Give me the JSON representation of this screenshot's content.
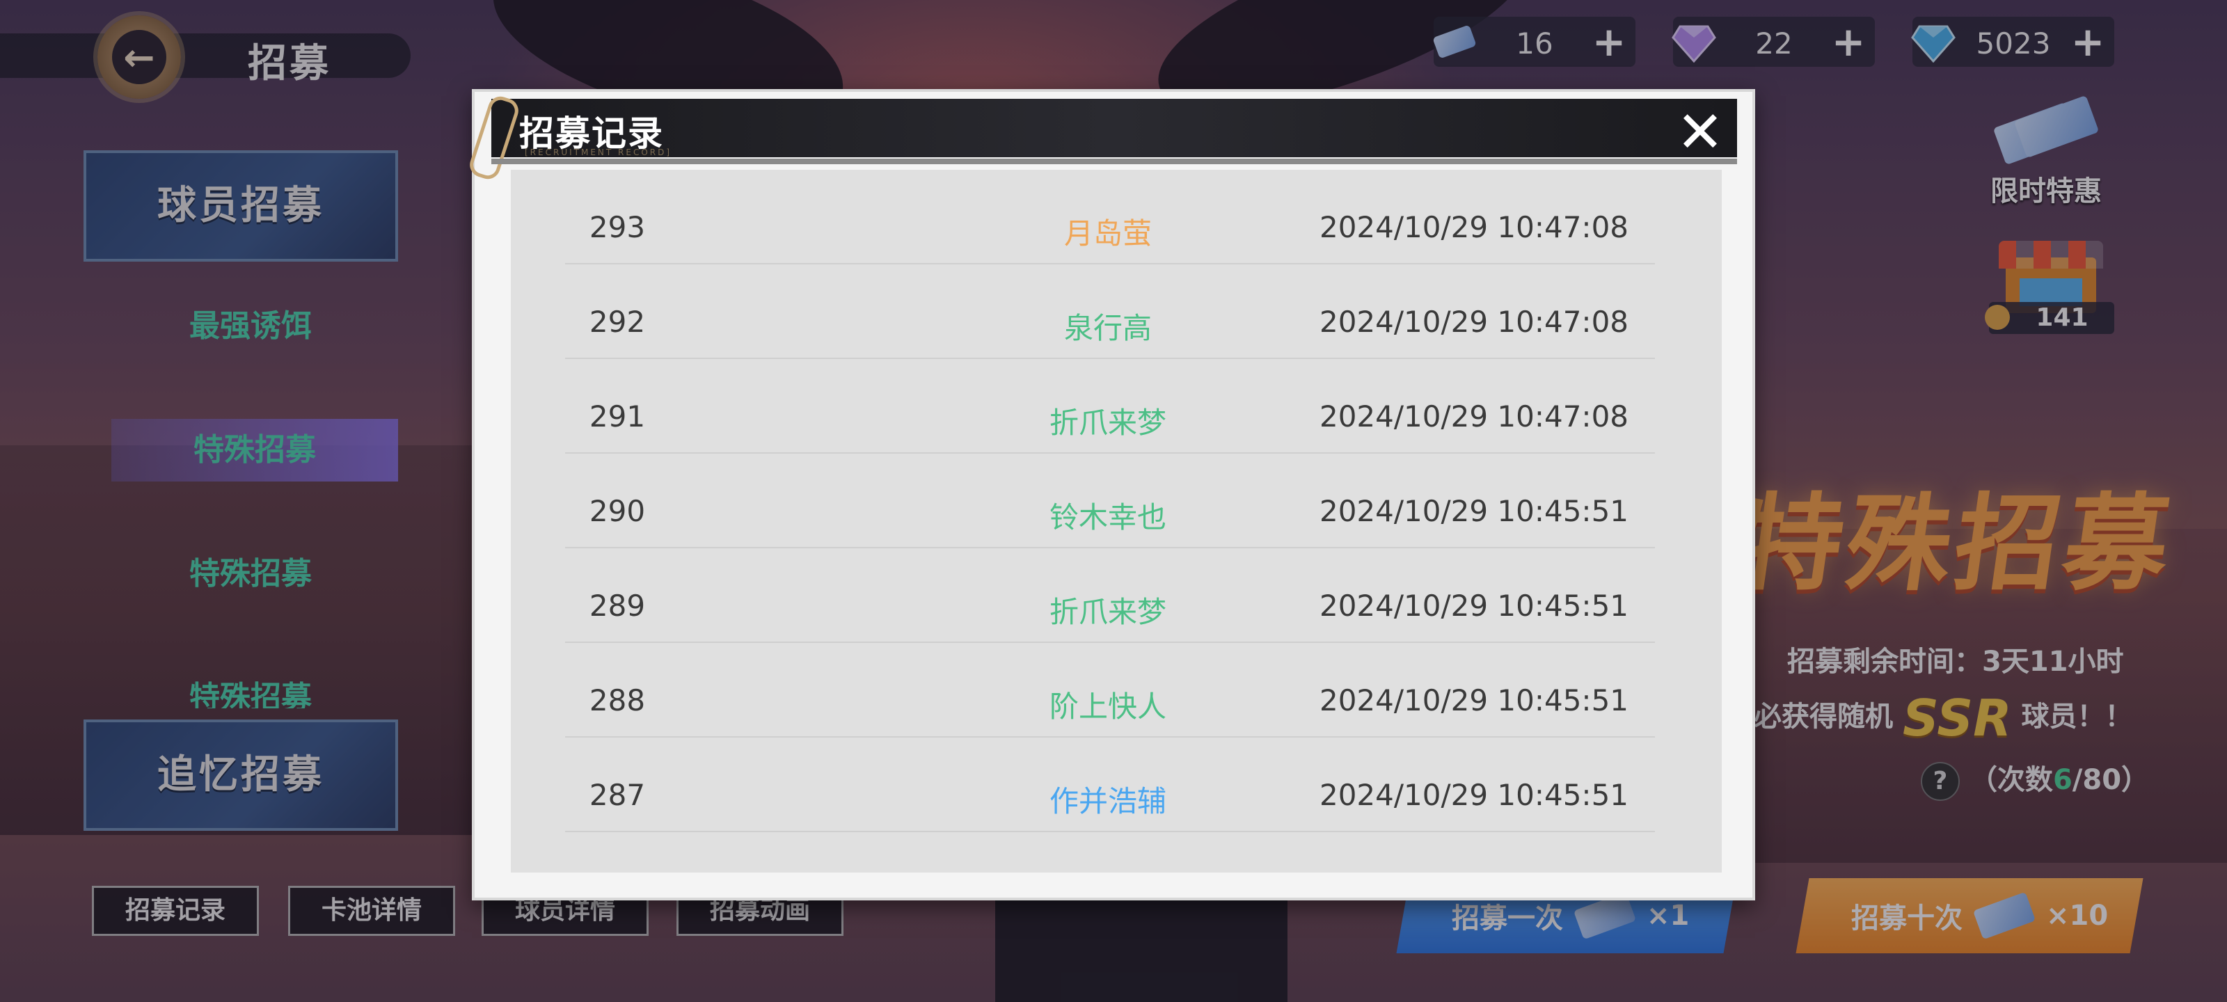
{
  "header": {
    "title": "招募"
  },
  "currencies": [
    {
      "icon": "ticket-icon",
      "value": "16",
      "plus": "+"
    },
    {
      "icon": "purple-gem-icon",
      "value": "22",
      "plus": "+"
    },
    {
      "icon": "blue-gem-icon",
      "value": "5023",
      "plus": "+"
    }
  ],
  "left_menu": {
    "player_recruit": "球员招募",
    "sub_items": [
      "最强诱饵",
      "特殊招募",
      "特殊招募",
      "特殊招募"
    ],
    "memory_recruit": "追忆招募"
  },
  "bottom_buttons": [
    "招募记录",
    "卡池详情",
    "球员详情",
    "招募动画"
  ],
  "draw": {
    "once_label": "招募一次",
    "once_count": "×1",
    "ten_label": "招募十次",
    "ten_count": "×10",
    "colors": {
      "once": "#3f8cf0",
      "ten": "#f39a3a"
    }
  },
  "right_panel": {
    "limited_offer": "限时特惠",
    "shop_count": "141",
    "banner": "特殊招募",
    "remaining_time": "招募剩余时间：3天11小时",
    "guarantee_prefix": "必获得随机",
    "ssr": "SSR",
    "guarantee_suffix": "球员！！",
    "count_prefix": "（次数",
    "count_current": "6",
    "count_total": "/80）"
  },
  "modal": {
    "title": "招募记录",
    "subtitle": "[RECRUITMENT RECORD]",
    "rows": [
      {
        "num": "293",
        "name": "月岛萤",
        "time": "2024/10/29 10:47:08",
        "color": "#f0a657"
      },
      {
        "num": "292",
        "name": "泉行高",
        "time": "2024/10/29 10:47:08",
        "color": "#4cbf86"
      },
      {
        "num": "291",
        "name": "折爪来梦",
        "time": "2024/10/29 10:47:08",
        "color": "#4cbf86"
      },
      {
        "num": "290",
        "name": "铃木幸也",
        "time": "2024/10/29 10:45:51",
        "color": "#4cbf86"
      },
      {
        "num": "289",
        "name": "折爪来梦",
        "time": "2024/10/29 10:45:51",
        "color": "#4cbf86"
      },
      {
        "num": "288",
        "name": "阶上快人",
        "time": "2024/10/29 10:45:51",
        "color": "#4cbf86"
      },
      {
        "num": "287",
        "name": "作并浩辅",
        "time": "2024/10/29 10:45:51",
        "color": "#4aa6f0"
      }
    ]
  }
}
